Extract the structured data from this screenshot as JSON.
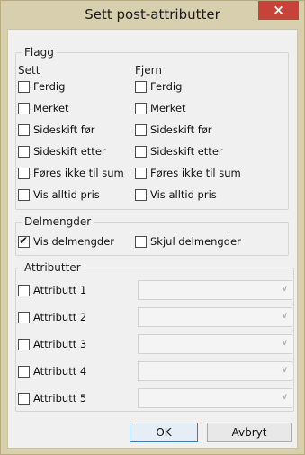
{
  "window": {
    "title": "Sett post-attributter",
    "close_label": "×"
  },
  "flagg": {
    "legend": "Flagg",
    "sett_header": "Sett",
    "fjern_header": "Fjern",
    "sett_items": [
      {
        "label": "Ferdig",
        "checked": false
      },
      {
        "label": "Merket",
        "checked": false
      },
      {
        "label": "Sideskift før",
        "checked": false
      },
      {
        "label": "Sideskift etter",
        "checked": false
      },
      {
        "label": "Føres ikke til sum",
        "checked": false
      },
      {
        "label": "Vis alltid pris",
        "checked": false
      }
    ],
    "fjern_items": [
      {
        "label": "Ferdig",
        "checked": false
      },
      {
        "label": "Merket",
        "checked": false
      },
      {
        "label": "Sideskift før",
        "checked": false
      },
      {
        "label": "Sideskift etter",
        "checked": false
      },
      {
        "label": "Føres ikke til sum",
        "checked": false
      },
      {
        "label": "Vis alltid pris",
        "checked": false
      }
    ]
  },
  "delmengder": {
    "legend": "Delmengder",
    "vis": {
      "label": "Vis delmengder",
      "checked": true
    },
    "skjul": {
      "label": "Skjul delmengder",
      "checked": false
    }
  },
  "attributter": {
    "legend": "Attributter",
    "items": [
      {
        "label": "Attributt 1",
        "checked": false,
        "value": ""
      },
      {
        "label": "Attributt 2",
        "checked": false,
        "value": ""
      },
      {
        "label": "Attributt 3",
        "checked": false,
        "value": ""
      },
      {
        "label": "Attributt 4",
        "checked": false,
        "value": ""
      },
      {
        "label": "Attributt 5",
        "checked": false,
        "value": ""
      }
    ],
    "dropdown_icon": "chevron-down-icon"
  },
  "buttons": {
    "ok": "OK",
    "cancel": "Avbryt"
  },
  "colors": {
    "frame": "#d8cfae",
    "close": "#c7433a",
    "client": "#f0f0f0",
    "default_border": "#3c7fb1"
  }
}
